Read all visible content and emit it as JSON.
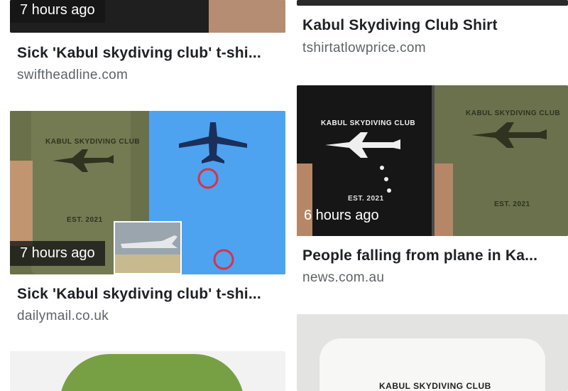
{
  "results": [
    {
      "title": "Sick 'Kabul skydiving club' t-shi...",
      "source": "swiftheadline.com",
      "time": "7 hours ago"
    },
    {
      "title": "Kabul Skydiving Club Shirt",
      "source": "tshirtatlowprice.com"
    },
    {
      "title": "Sick 'Kabul skydiving club' t-shi...",
      "source": "dailymail.co.uk",
      "time": "7 hours ago",
      "shirt_print": {
        "line1": "KABUL SKYDIVING CLUB",
        "line2": "EST. 2021"
      }
    },
    {
      "title": "People falling from plane in Ka...",
      "source": "news.com.au",
      "time": "6 hours ago",
      "shirt_print_black": {
        "line1": "KABUL SKYDIVING CLUB",
        "line2": "EST. 2021"
      },
      "shirt_print_green": {
        "line1": "KABUL SKYDIVING CLUB",
        "line2": "EST. 2021"
      }
    },
    {},
    {
      "shirt_print": {
        "line1": "KABUL SKYDIVING CLUB"
      }
    }
  ],
  "colors": {
    "title": "#202124",
    "source": "#5f6368",
    "sky": "#4da3ef",
    "olive_shirt": "#6a7049",
    "circle_marker": "#d9324a"
  }
}
